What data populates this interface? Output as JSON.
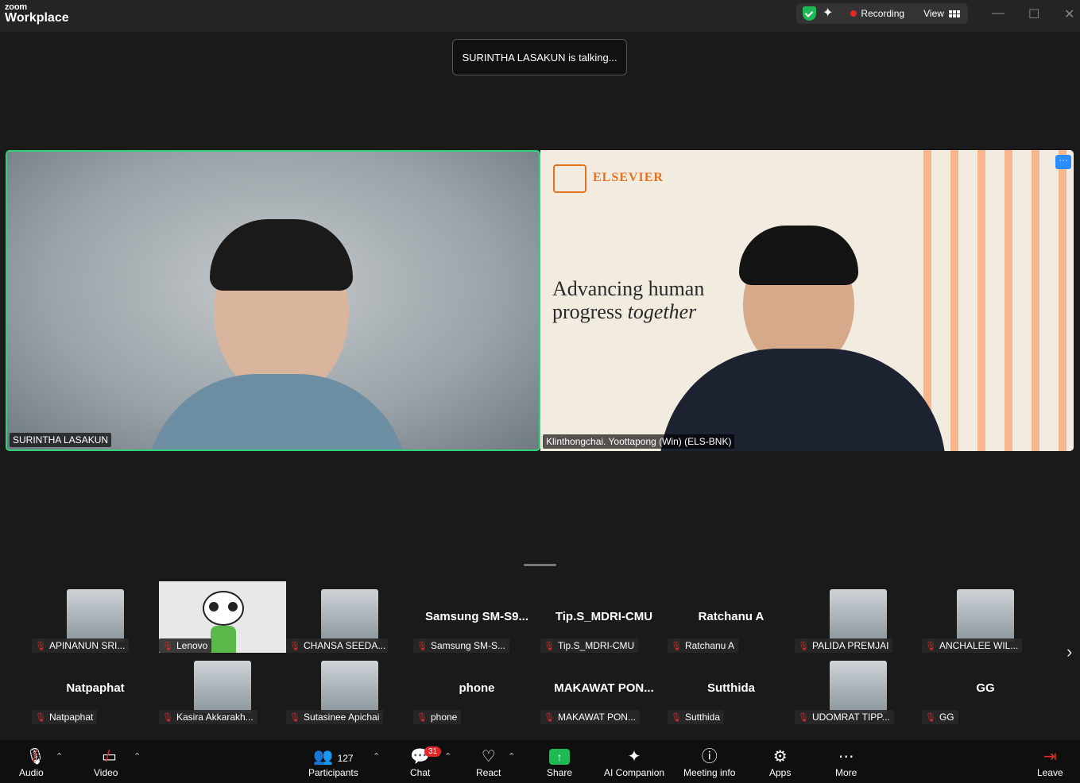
{
  "app": {
    "logo_small": "zoom",
    "logo_big": "Workplace"
  },
  "topbar": {
    "recording_label": "Recording",
    "view_label": "View"
  },
  "talking_banner": "SURINTHA LASAKUN is talking...",
  "main_videos": [
    {
      "name": "SURINTHA LASAKUN"
    },
    {
      "name": "Klinthongchai. Yoottapong (Win) (ELS-BNK)",
      "brand": "ELSEVIER",
      "slogan_line1": "Advancing human",
      "slogan_line2a": "progress ",
      "slogan_line2b": "together",
      "more_label": "···"
    }
  ],
  "gallery": [
    {
      "name": "APINANUN SRI...",
      "header": "",
      "photo": true
    },
    {
      "name": "Lenovo",
      "header": "",
      "avatar": "panda"
    },
    {
      "name": "CHANSA SEEDA...",
      "header": "",
      "photo": true
    },
    {
      "name": "Samsung SM-S...",
      "header": "Samsung  SM-S9..."
    },
    {
      "name": "Tip.S_MDRI-CMU",
      "header": "Tip.S_MDRI-CMU"
    },
    {
      "name": "Ratchanu A",
      "header": "Ratchanu A"
    },
    {
      "name": "PALIDA PREMJAI",
      "header": "",
      "photo": true
    },
    {
      "name": "ANCHALEE WIL...",
      "header": "",
      "photo": true
    },
    {
      "name": "Natpaphat",
      "header": "Natpaphat"
    },
    {
      "name": "Kasira Akkarakh...",
      "header": "",
      "photo": true
    },
    {
      "name": "Sutasinee Apichai",
      "header": "",
      "photo": true
    },
    {
      "name": "phone",
      "header": "phone"
    },
    {
      "name": "MAKAWAT PON...",
      "header": "MAKAWAT  PON..."
    },
    {
      "name": "Sutthida",
      "header": "Sutthida"
    },
    {
      "name": "UDOMRAT TIPP...",
      "header": "",
      "photo": true
    },
    {
      "name": "GG",
      "header": "GG"
    }
  ],
  "toolbar": {
    "audio": "Audio",
    "video": "Video",
    "participants": "Participants",
    "participants_count": "127",
    "chat": "Chat",
    "chat_badge": "31",
    "react": "React",
    "share": "Share",
    "ai_companion": "AI Companion",
    "meeting_info": "Meeting info",
    "apps": "Apps",
    "more": "More",
    "leave": "Leave"
  },
  "colors": {
    "active_speaker": "#2fd27a",
    "share_green": "#1db954",
    "recording_red": "#e02828",
    "elsevier_orange": "#e9711c"
  }
}
